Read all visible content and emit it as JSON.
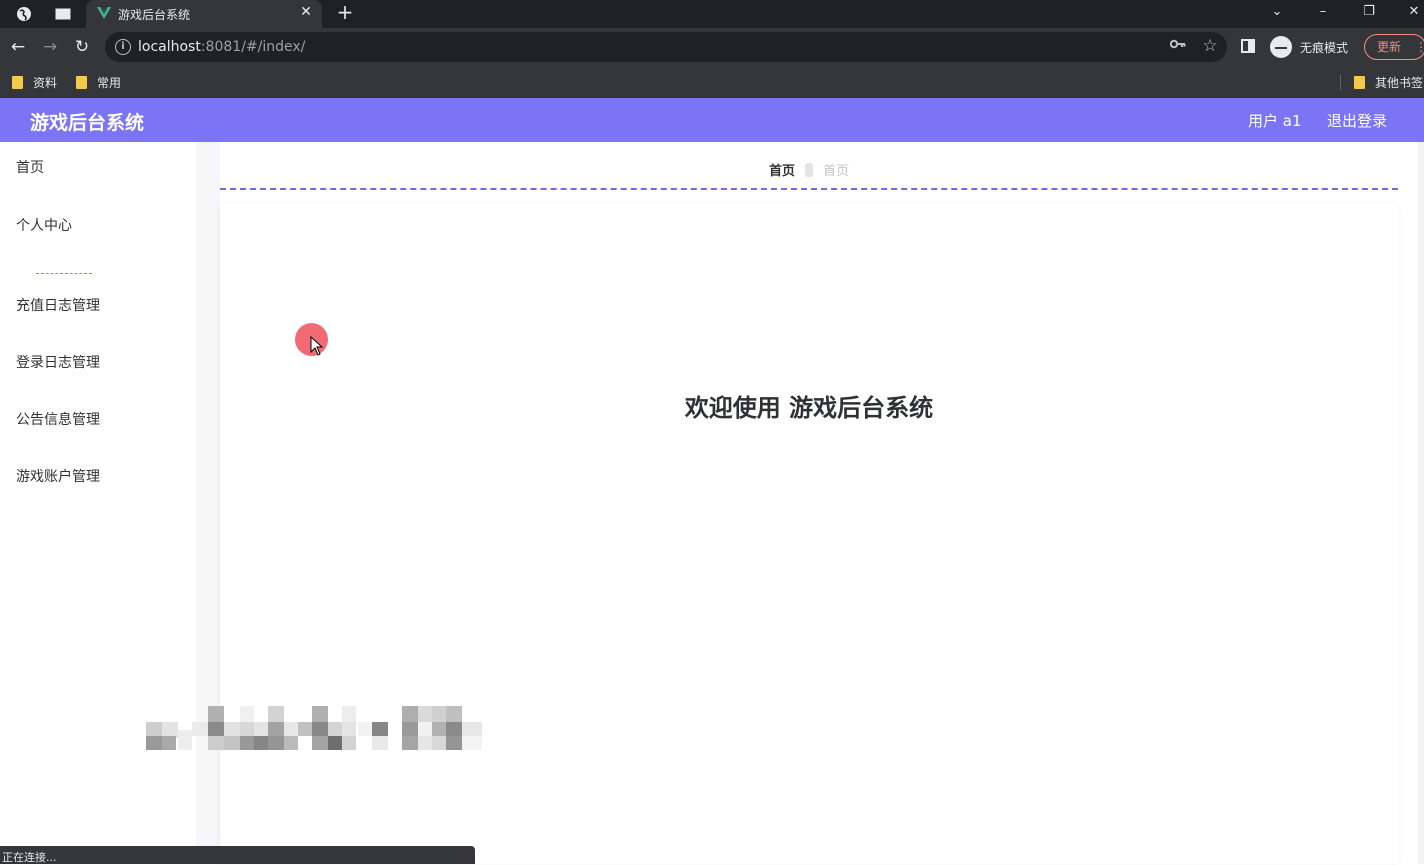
{
  "browser": {
    "tab_title": "游戏后台系统",
    "url_host": "localhost",
    "url_rest": ":8081/#/index/",
    "incognito_label": "无痕模式",
    "update_label": "更新",
    "bookmarks": [
      {
        "label": "资料"
      },
      {
        "label": "常用"
      }
    ],
    "other_bookmarks": "其他书签",
    "status_text": "正在连接..."
  },
  "app": {
    "title": "游戏后台系统",
    "user_label": "用户 a1",
    "logout_label": "退出登录",
    "accent_color": "#7b75f5"
  },
  "sidebar": {
    "items": [
      {
        "label": "首页"
      },
      {
        "label": "个人中心"
      },
      {
        "label": "充值日志管理"
      },
      {
        "label": "登录日志管理"
      },
      {
        "label": "公告信息管理"
      },
      {
        "label": "游戏账户管理"
      }
    ]
  },
  "breadcrumb": {
    "current": "首页",
    "last": "首页"
  },
  "main": {
    "welcome_text": "欢迎使用 游戏后台系统"
  }
}
